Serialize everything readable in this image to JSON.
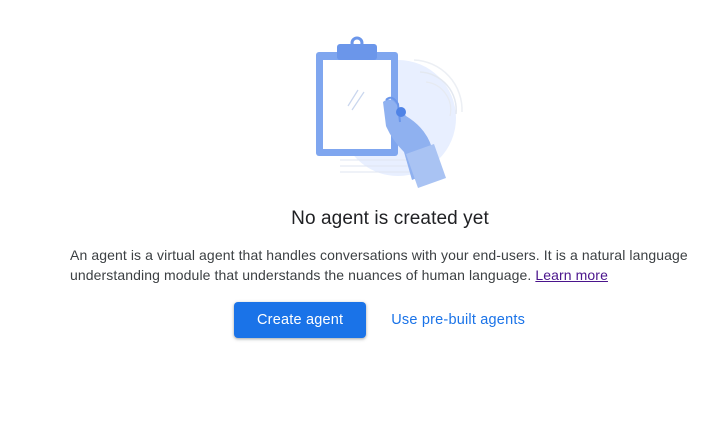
{
  "empty_state": {
    "illustration": "clipboard-hand-illustration",
    "title": "No agent is created yet",
    "description": "An agent is a virtual agent that handles conversations with your end-users. It is a natural language understanding module that understands the nuances of human language.",
    "learn_more": "Learn more"
  },
  "actions": {
    "create_label": "Create agent",
    "prebuilt_label": "Use pre-built agents"
  },
  "colors": {
    "primary": "#1a73e8",
    "illustration_blue": "#7fa6ef",
    "illustration_light": "#e8efff",
    "link_visited": "#4a148c"
  }
}
